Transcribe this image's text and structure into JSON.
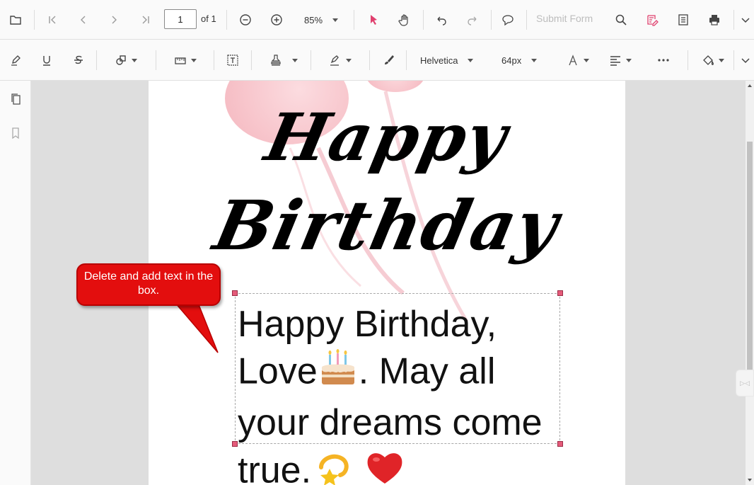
{
  "toolbar": {
    "page_number": "1",
    "page_of": "of 1",
    "zoom": "85%",
    "submit_form": "Submit Form"
  },
  "format_toolbar": {
    "font_family": "Helvetica",
    "font_size": "64px"
  },
  "document": {
    "title_line1": "Happy",
    "title_line2": "Birthday",
    "message_part1": "Happy Birthday, Love",
    "message_part2": ". May all your dreams come true.",
    "callout_text": "Delete and add text in the box."
  },
  "colors": {
    "accent": "#e0406e",
    "callout": "#e30e0e",
    "handle": "#e55b7a"
  },
  "side_tab_text": "▷◁"
}
